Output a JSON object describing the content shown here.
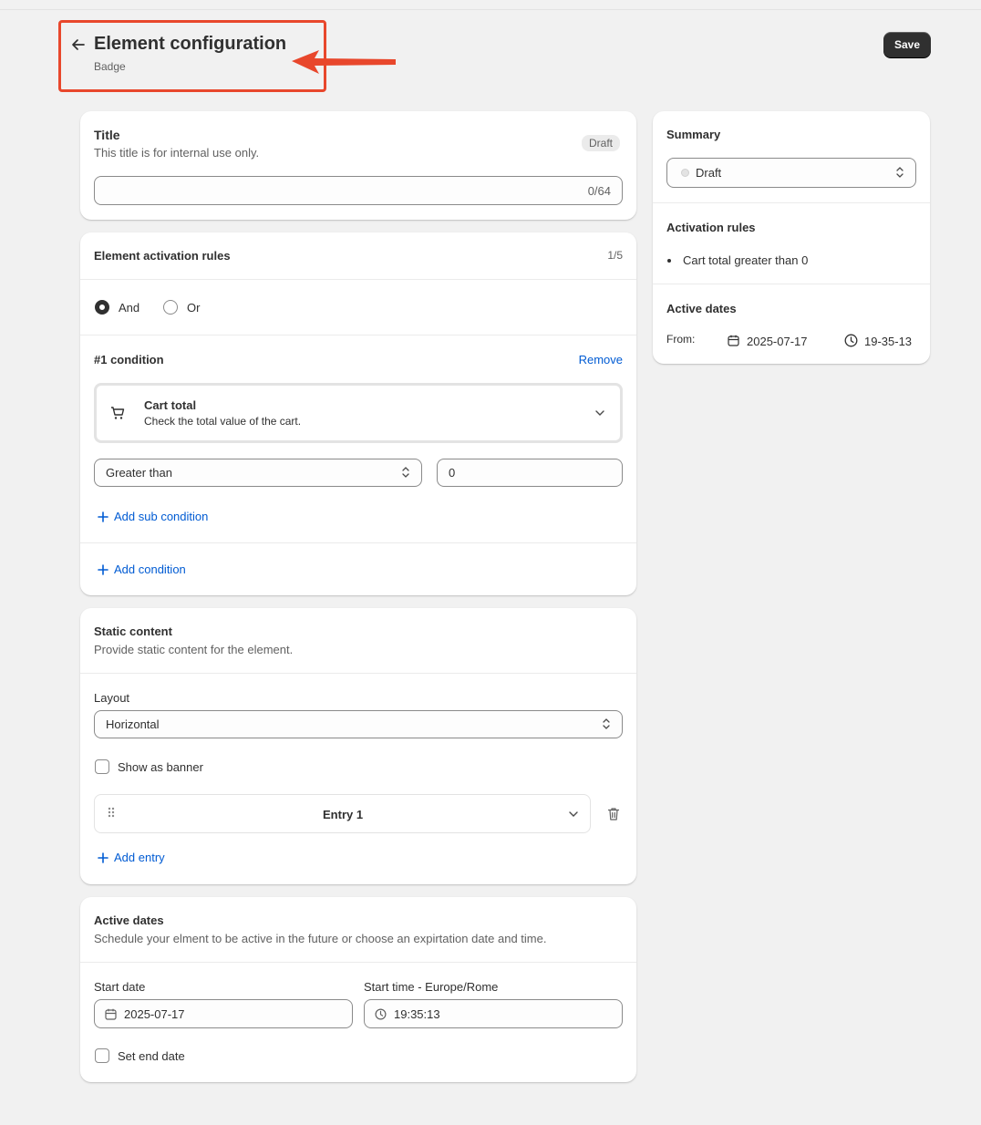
{
  "header": {
    "title": "Element configuration",
    "subtitle": "Badge",
    "save_label": "Save"
  },
  "title_card": {
    "heading": "Title",
    "help": "This title is for internal use only.",
    "status_badge": "Draft",
    "input_value": "",
    "char_count": "0/64"
  },
  "rules_card": {
    "heading": "Element activation rules",
    "count": "1/5",
    "logic_options": [
      "And",
      "Or"
    ],
    "logic_selected": "And",
    "condition_heading": "#1 condition",
    "remove_label": "Remove",
    "condition_type_title": "Cart total",
    "condition_type_desc": "Check the total value of the cart.",
    "operator_value": "Greater than",
    "amount_value": "0",
    "add_sub_condition_label": "Add sub condition",
    "add_condition_label": "Add condition"
  },
  "static_card": {
    "heading": "Static content",
    "help": "Provide static content for the element.",
    "layout_label": "Layout",
    "layout_value": "Horizontal",
    "banner_label": "Show as banner",
    "entry_label": "Entry 1",
    "add_entry_label": "Add entry"
  },
  "dates_card": {
    "heading": "Active dates",
    "help": "Schedule your elment to be active in the future or choose an expirtation date and time.",
    "start_date_label": "Start date",
    "start_date_value": "2025-07-17",
    "start_time_label": "Start time - Europe/Rome",
    "start_time_value": "19:35:13",
    "end_date_label": "Set end date"
  },
  "summary_card": {
    "heading": "Summary",
    "status_value": "Draft",
    "rules_heading": "Activation rules",
    "rules_items": [
      "Cart total greater than 0"
    ],
    "dates_heading": "Active dates",
    "from_label": "From:",
    "from_date": "2025-07-17",
    "from_time": "19-35-13"
  },
  "colors": {
    "accent_link": "#005bd3",
    "annotation": "#e8472c",
    "primary_button": "#303030"
  }
}
